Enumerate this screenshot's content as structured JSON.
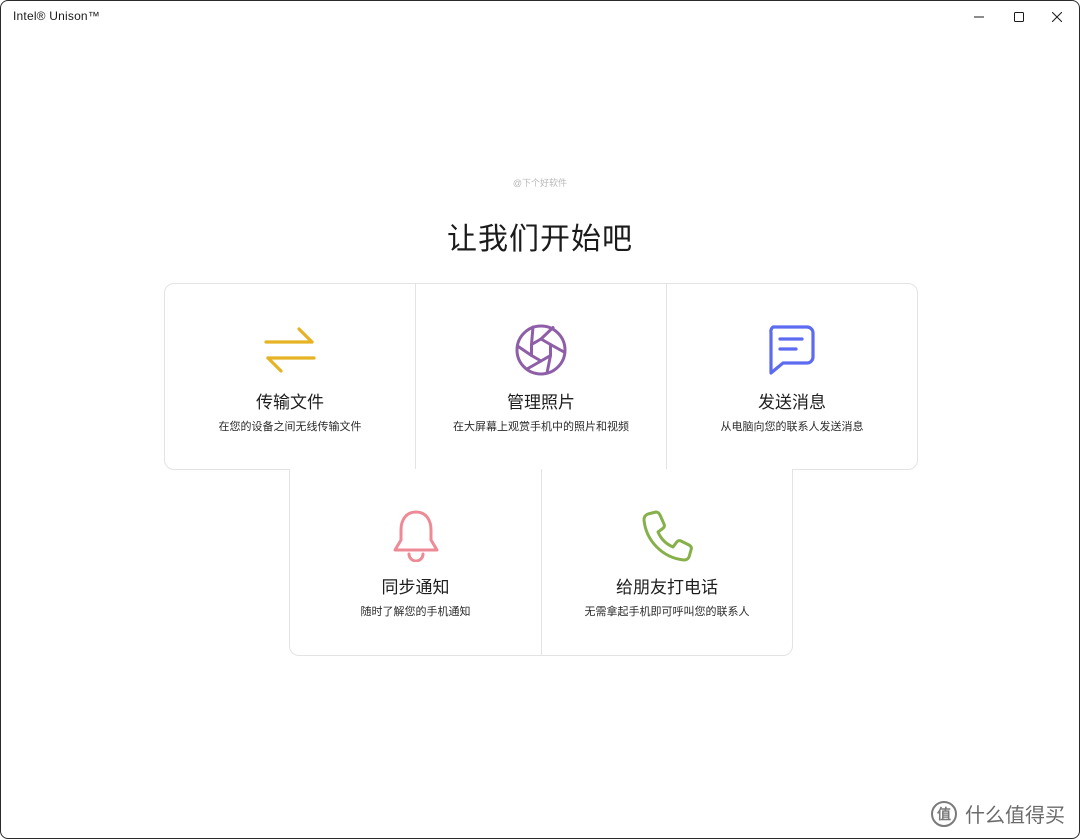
{
  "window": {
    "title": "Intel® Unison™"
  },
  "watermark": "@下个好软件",
  "heading": "让我们开始吧",
  "cards": [
    {
      "icon": "transfer-arrows-icon",
      "title": "传输文件",
      "desc": "在您的设备之间无线传输文件",
      "color": "#e6b325"
    },
    {
      "icon": "camera-aperture-icon",
      "title": "管理照片",
      "desc": "在大屏幕上观赏手机中的照片和视频",
      "color": "#8e5fa8"
    },
    {
      "icon": "chat-message-icon",
      "title": "发送消息",
      "desc": "从电脑向您的联系人发送消息",
      "color": "#5c6bf0"
    },
    {
      "icon": "bell-icon",
      "title": "同步通知",
      "desc": "随时了解您的手机通知",
      "color": "#ee8a95"
    },
    {
      "icon": "phone-icon",
      "title": "给朋友打电话",
      "desc": "无需拿起手机即可呼叫您的联系人",
      "color": "#86b04a"
    }
  ],
  "brand": {
    "logo_char": "值",
    "text": "什么值得买"
  }
}
